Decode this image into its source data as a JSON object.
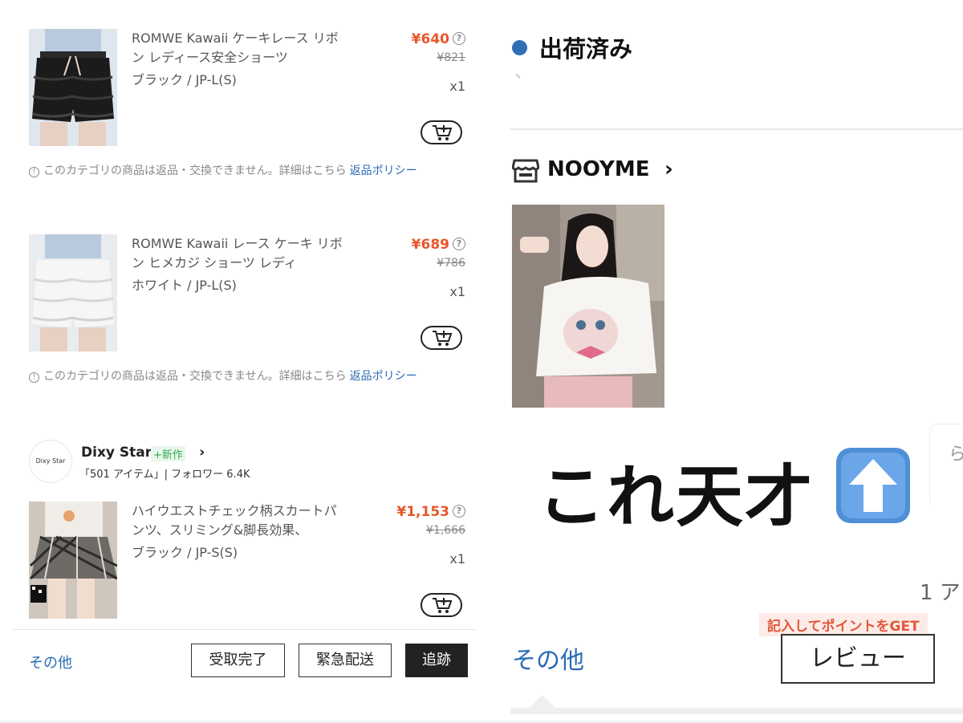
{
  "left": {
    "products": [
      {
        "title": "ROMWE Kawaii ケーキレース リボン レディース安全ショーツ",
        "variant": "ブラック / JP-L(S)",
        "price": "¥640",
        "original_price": "¥821",
        "qty": "x1",
        "image_icon": "black-lace-shorts-photo"
      },
      {
        "title": "ROMWE Kawaii レース ケーキ リボン ヒメカジ ショーツ レディ",
        "variant": "ホワイト / JP-L(S)",
        "price": "¥689",
        "original_price": "¥786",
        "qty": "x1",
        "image_icon": "white-lace-shorts-photo"
      },
      {
        "title": "ハイウエストチェック柄スカートパンツ、スリミング&脚長効果、",
        "variant": "ブラック / JP-S(S)",
        "price": "¥1,153",
        "original_price": "¥1,666",
        "qty": "x1",
        "image_icon": "plaid-skirt-photo"
      }
    ],
    "notice": {
      "text": "このカテゴリの商品は返品・交換できません。詳細はこちら",
      "link": "返品ポリシー"
    },
    "shop": {
      "logo_text": "Dixy Star",
      "name": "Dixy Star",
      "badge": "+新作",
      "meta": "「501 アイテム」| フォロワー 6.4K"
    },
    "bottom_bar": {
      "other": "その他",
      "received": "受取完了",
      "urgent": "緊急配送",
      "track": "追跡"
    }
  },
  "right": {
    "status": "出荷済み",
    "faint_mark": "⸌",
    "store_name": "NOOYME",
    "overlay_text": "これ天才",
    "edge_fragment": "ら",
    "edge_text": "1 ア",
    "promo": "記入してポイントをGET",
    "other": "その他",
    "review": "レビュー"
  },
  "colors": {
    "price": "#e8562a",
    "link": "#2a6bb5",
    "status_dot": "#2f6fb6",
    "promo_bg": "#fdebe8",
    "promo_text": "#e0593b",
    "new_badge": "#2fa84f"
  }
}
